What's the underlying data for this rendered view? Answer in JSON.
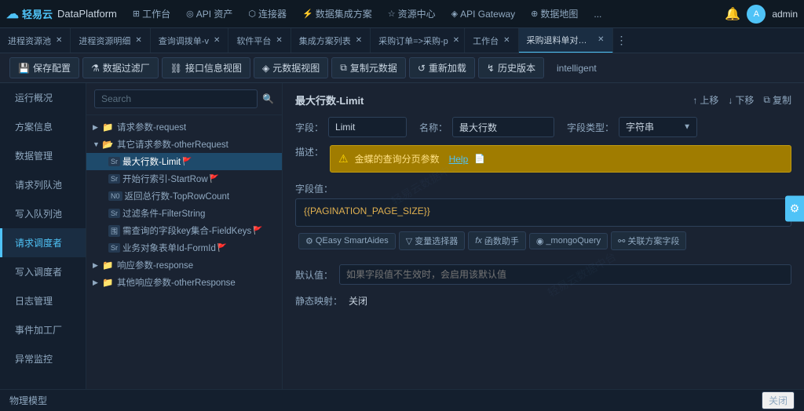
{
  "app": {
    "logo": "轻易云",
    "platform": "DataPlatform",
    "admin_label": "admin"
  },
  "top_nav": {
    "items": [
      {
        "label": "工作台",
        "icon": "⊞"
      },
      {
        "label": "API 资产",
        "icon": "◎"
      },
      {
        "label": "连接器",
        "icon": "⬡"
      },
      {
        "label": "数据集成方案",
        "icon": "⚡"
      },
      {
        "label": "资源中心",
        "icon": "☆"
      },
      {
        "label": "API Gateway",
        "icon": "◈"
      },
      {
        "label": "数据地图",
        "icon": "⊕"
      },
      {
        "label": "...",
        "icon": ""
      }
    ]
  },
  "tabs": [
    {
      "label": "进程资源池",
      "active": false
    },
    {
      "label": "进程资源明细",
      "active": false
    },
    {
      "label": "查询调拨单-v",
      "active": false
    },
    {
      "label": "软件平台",
      "active": false
    },
    {
      "label": "集成方案列表",
      "active": false
    },
    {
      "label": "采购订单=>采购-p",
      "active": false
    },
    {
      "label": "工作台",
      "active": false
    },
    {
      "label": "采购退料单对接采购退货单",
      "active": true
    }
  ],
  "toolbar": {
    "save_label": "保存配置",
    "filter_label": "数据过滤厂",
    "interface_label": "接口信息视图",
    "meta_label": "元数据视图",
    "copy_label": "复制元数据",
    "reload_label": "重新加载",
    "history_label": "历史版本",
    "intelligent_label": "intelligent"
  },
  "sidebar": {
    "items": [
      {
        "label": "运行概况",
        "active": false
      },
      {
        "label": "方案信息",
        "active": false
      },
      {
        "label": "数据管理",
        "active": false
      },
      {
        "label": "请求列队池",
        "active": false
      },
      {
        "label": "写入队列池",
        "active": false
      },
      {
        "label": "请求调度者",
        "active": true
      },
      {
        "label": "写入调度者",
        "active": false
      },
      {
        "label": "日志管理",
        "active": false
      },
      {
        "label": "事件加工厂",
        "active": false
      },
      {
        "label": "异常监控",
        "active": false
      }
    ]
  },
  "tree": {
    "search_placeholder": "Search",
    "items": [
      {
        "level": 1,
        "type": "folder",
        "label": "请求参数-request",
        "collapsed": true,
        "tag": ""
      },
      {
        "level": 1,
        "type": "folder",
        "label": "其它请求参数-otherRequest",
        "collapsed": false,
        "tag": ""
      },
      {
        "level": 2,
        "type": "item",
        "label": "最大行数-Limit",
        "tag": "Sr",
        "selected": true,
        "flag": true
      },
      {
        "level": 2,
        "type": "item",
        "label": "开始行索引-StartRow",
        "tag": "Sr",
        "selected": false,
        "flag": true
      },
      {
        "level": 2,
        "type": "item",
        "label": "返回总行数-TopRowCount",
        "tag": "N0",
        "selected": false,
        "flag": false
      },
      {
        "level": 2,
        "type": "item",
        "label": "过滤条件-FilterString",
        "tag": "Sr",
        "selected": false,
        "flag": false
      },
      {
        "level": 2,
        "type": "item",
        "label": "需查询的字段key集合-FieldKeys",
        "tag": "围",
        "selected": false,
        "flag": true
      },
      {
        "level": 2,
        "type": "item",
        "label": "业务对象表单Id-FormId",
        "tag": "Sr",
        "selected": false,
        "flag": true
      },
      {
        "level": 1,
        "type": "folder",
        "label": "响应参数-response",
        "collapsed": true,
        "tag": ""
      },
      {
        "level": 1,
        "type": "folder",
        "label": "其他响应参数-otherResponse",
        "collapsed": true,
        "tag": ""
      }
    ]
  },
  "detail": {
    "title": "最大行数-Limit",
    "field_label": "字段：",
    "field_value": "Limit",
    "name_label": "名称：",
    "name_value": "最大行数",
    "type_label": "字段类型：",
    "type_value": "字符串",
    "desc_label": "描述：",
    "desc_text": "金蝶的查询分页参数",
    "desc_help": "Help",
    "value_label": "字段值：",
    "value_text": "{{PAGINATION_PAGE_SIZE}}",
    "btns": [
      {
        "label": "QEasy SmartAides",
        "icon": "⚙"
      },
      {
        "label": "变量选择器",
        "icon": "▽"
      },
      {
        "label": "函数助手",
        "icon": "fx"
      },
      {
        "label": "_mongoQuery",
        "icon": "◉"
      },
      {
        "label": "关联方案字段",
        "icon": "⚯"
      }
    ],
    "default_label": "默认值：",
    "default_placeholder": "如果字段值不生效时，会启用该默认值",
    "static_label": "静态映射：",
    "static_value": "关闭",
    "bottom_title": "物理模型",
    "bottom_close": "关闭"
  },
  "actions": {
    "up": "上移",
    "down": "下移",
    "copy": "复制"
  }
}
